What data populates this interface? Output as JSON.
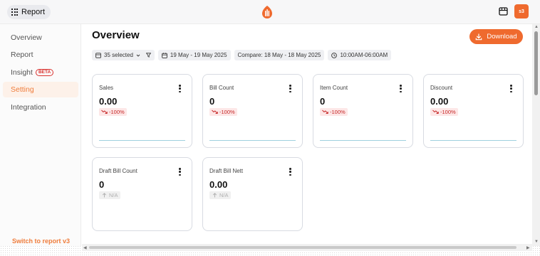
{
  "topbar": {
    "report_label": "Report",
    "avatar_initials": "s3",
    "brand_color": "#ef6a2e"
  },
  "sidebar": {
    "items": [
      {
        "label": "Overview",
        "active": false
      },
      {
        "label": "Report",
        "active": false
      },
      {
        "label": "Insight",
        "badge": "BETA",
        "active": false
      },
      {
        "label": "Setting",
        "active": true
      },
      {
        "label": "Integration",
        "active": false
      }
    ],
    "switch_label": "Switch to report v3"
  },
  "main": {
    "title": "Overview",
    "download_label": "Download",
    "filters": {
      "outlets": "35 selected",
      "date_range": "19 May - 19 May 2025",
      "compare": "Compare: 18 May - 18 May 2025",
      "time_range": "10:00AM-06:00AM"
    },
    "cards": [
      {
        "title": "Sales",
        "value": "0.00",
        "delta": "-100%",
        "delta_type": "down"
      },
      {
        "title": "Bill Count",
        "value": "0",
        "delta": "-100%",
        "delta_type": "down"
      },
      {
        "title": "Item Count",
        "value": "0",
        "delta": "-100%",
        "delta_type": "down"
      },
      {
        "title": "Discount",
        "value": "0.00",
        "delta": "-100%",
        "delta_type": "down"
      },
      {
        "title": "Draft Bill Count",
        "value": "0",
        "delta": "N/A",
        "delta_type": "na"
      },
      {
        "title": "Draft Bill Nett",
        "value": "0.00",
        "delta": "N/A",
        "delta_type": "na"
      }
    ]
  },
  "icons": {
    "apps": "grid-icon",
    "logo": "brand-logo-icon",
    "store": "store-icon",
    "download": "download-icon",
    "outlet": "store-icon",
    "filter": "filter-icon",
    "calendar": "calendar-icon",
    "clock": "clock-icon",
    "trend_down": "trend-down-icon",
    "trend_up": "trend-up-icon",
    "more": "kebab-icon"
  }
}
